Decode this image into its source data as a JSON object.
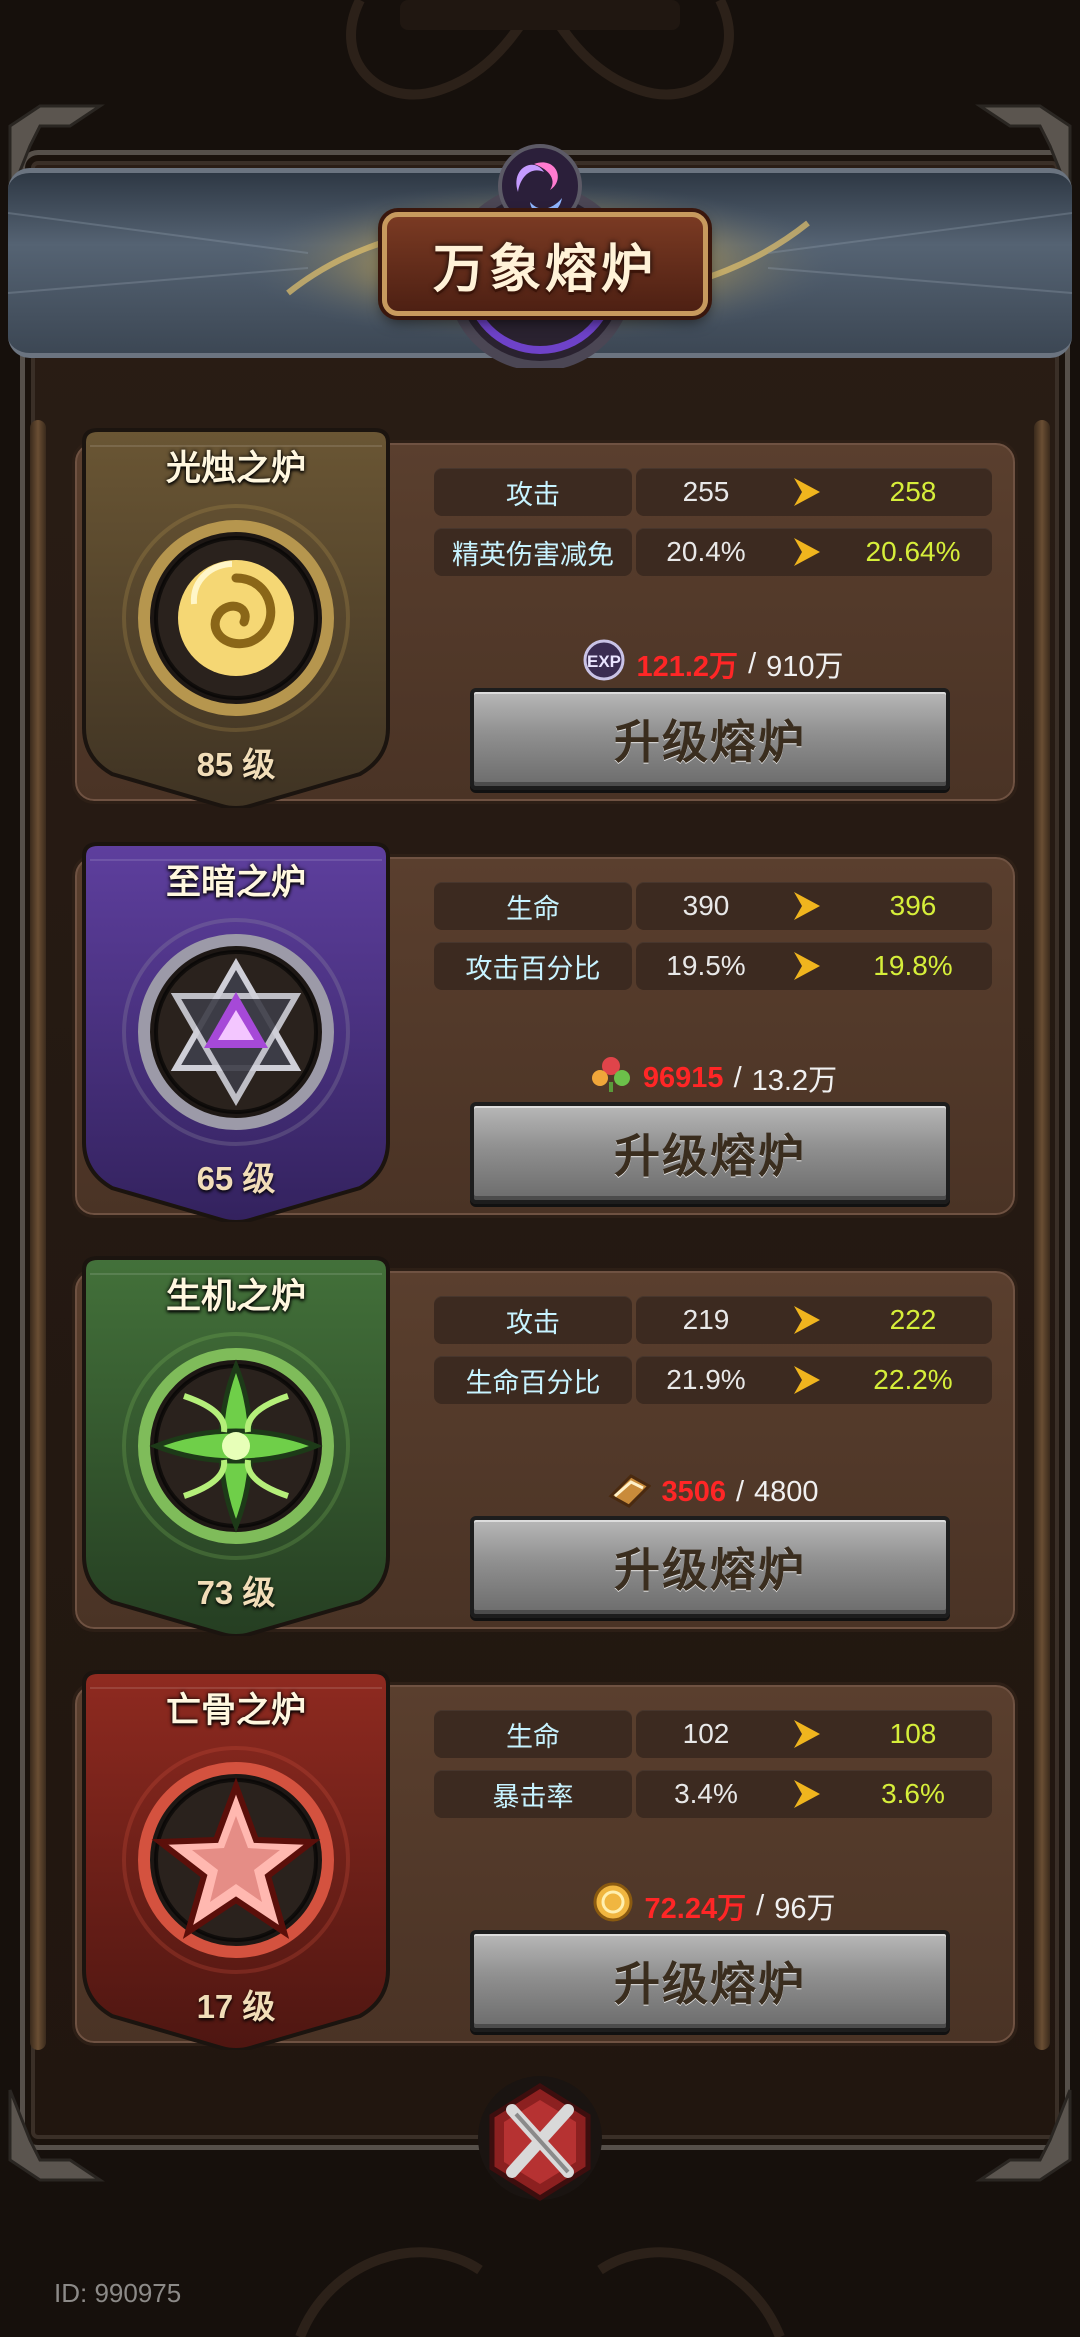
{
  "header": {
    "title": "万象熔炉"
  },
  "furnaces": [
    {
      "name": "光烛之炉",
      "level": "85 级",
      "theme": "gold",
      "stats": [
        {
          "label": "攻击",
          "from": "255",
          "to": "258"
        },
        {
          "label": "精英伤害减免",
          "from": "20.4%",
          "to": "20.64%"
        }
      ],
      "cost": {
        "icon": "exp-icon",
        "have": "121.2万",
        "sep": "/",
        "need": "910万"
      },
      "button": "升级熔炉"
    },
    {
      "name": "至暗之炉",
      "level": "65 级",
      "theme": "purple",
      "stats": [
        {
          "label": "生命",
          "from": "390",
          "to": "396"
        },
        {
          "label": "攻击百分比",
          "from": "19.5%",
          "to": "19.8%"
        }
      ],
      "cost": {
        "icon": "flower-icon",
        "have": "96915",
        "sep": "/",
        "need": "13.2万"
      },
      "button": "升级熔炉"
    },
    {
      "name": "生机之炉",
      "level": "73 级",
      "theme": "green",
      "stats": [
        {
          "label": "攻击",
          "from": "219",
          "to": "222"
        },
        {
          "label": "生命百分比",
          "from": "21.9%",
          "to": "22.2%"
        }
      ],
      "cost": {
        "icon": "book-icon",
        "have": "3506",
        "sep": "/",
        "need": "4800"
      },
      "button": "升级熔炉"
    },
    {
      "name": "亡骨之炉",
      "level": "17 级",
      "theme": "red",
      "stats": [
        {
          "label": "生命",
          "from": "102",
          "to": "108"
        },
        {
          "label": "暴击率",
          "from": "3.4%",
          "to": "3.6%"
        }
      ],
      "cost": {
        "icon": "coin-icon",
        "have": "72.24万",
        "sep": "/",
        "need": "96万"
      },
      "button": "升级熔炉"
    }
  ],
  "footer": {
    "user_id": "ID: 990975",
    "close_icon": "close-icon"
  },
  "colors": {
    "stat_label": "#c7f3ff",
    "stat_new": "#d6ee3a",
    "cost_have": "#ff2626",
    "arrow": "#f0b51e",
    "gold": "#c9a24c",
    "purple": "#6b3fb0",
    "green": "#3f7a32",
    "red": "#9c2e22"
  }
}
